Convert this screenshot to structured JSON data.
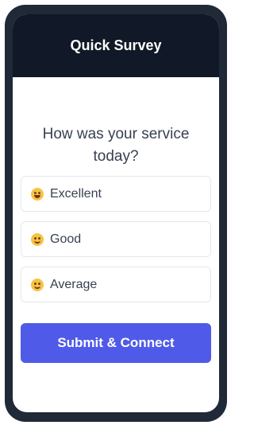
{
  "header": {
    "title": "Quick Survey"
  },
  "survey": {
    "question": "How was your service today?",
    "options": [
      {
        "label": "Excellent",
        "icon": "grinning-face-icon"
      },
      {
        "label": "Good",
        "icon": "smiling-face-icon"
      },
      {
        "label": "Average",
        "icon": "smiling-face-icon"
      }
    ],
    "submit_label": "Submit & Connect"
  },
  "colors": {
    "frame": "#1f2937",
    "header_bg": "#111827",
    "accent": "#4f5be8"
  }
}
